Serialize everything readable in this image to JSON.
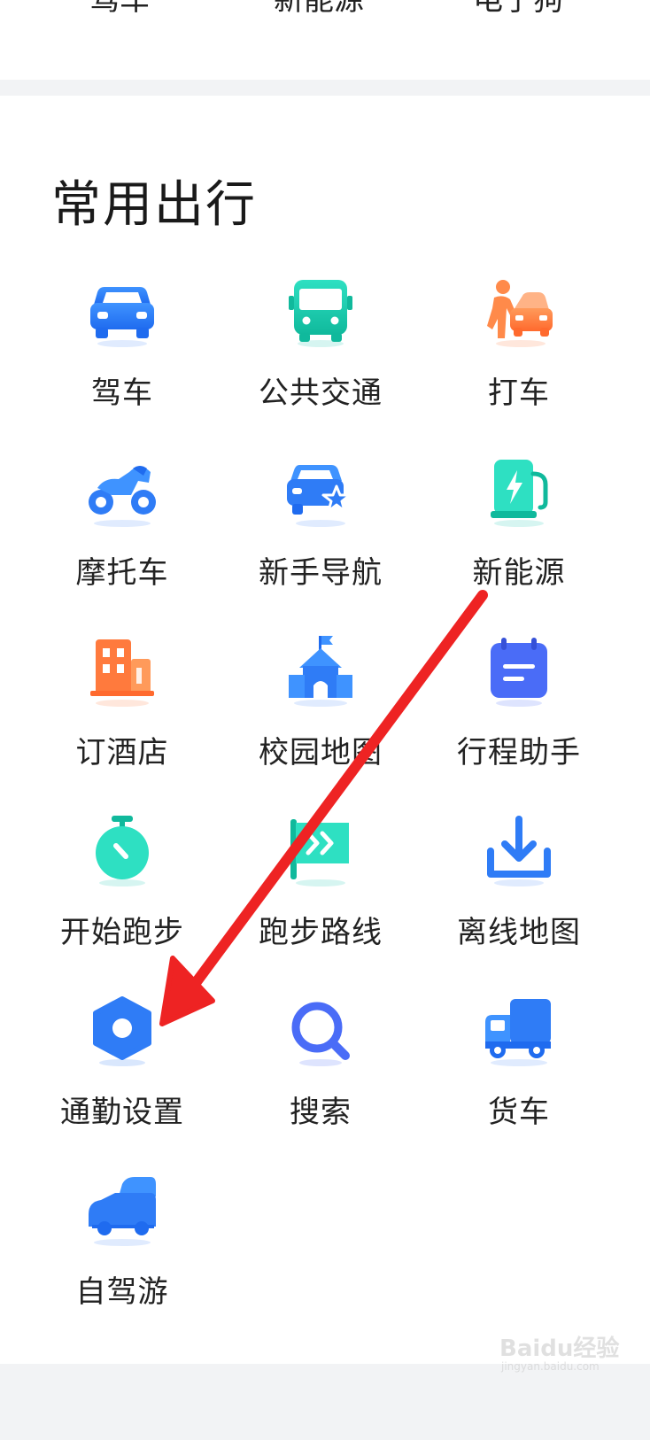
{
  "top_row": [
    "驾车",
    "新能源",
    "电子狗"
  ],
  "section": {
    "title": "常用出行"
  },
  "items": [
    {
      "label": "驾车",
      "icon": "car-icon"
    },
    {
      "label": "公共交通",
      "icon": "bus-icon"
    },
    {
      "label": "打车",
      "icon": "taxi-icon"
    },
    {
      "label": "摩托车",
      "icon": "motorcycle-icon"
    },
    {
      "label": "新手导航",
      "icon": "newbie-car-star-icon"
    },
    {
      "label": "新能源",
      "icon": "charging-station-icon"
    },
    {
      "label": "订酒店",
      "icon": "hotel-icon"
    },
    {
      "label": "校园地图",
      "icon": "campus-icon"
    },
    {
      "label": "行程助手",
      "icon": "calendar-icon"
    },
    {
      "label": "开始跑步",
      "icon": "stopwatch-icon"
    },
    {
      "label": "跑步路线",
      "icon": "route-flag-icon"
    },
    {
      "label": "离线地图",
      "icon": "download-icon"
    },
    {
      "label": "通勤设置",
      "icon": "hex-nut-icon"
    },
    {
      "label": "搜索",
      "icon": "search-icon"
    },
    {
      "label": "货车",
      "icon": "truck-icon"
    },
    {
      "label": "自驾游",
      "icon": "road-trip-car-icon"
    }
  ],
  "colors": {
    "blue": "#2f7cf6",
    "teal": "#19c9b0",
    "orange": "#ff7a3d",
    "annotation_red": "#ee2323",
    "divider": "#f2f3f5"
  },
  "watermark": {
    "brand": "Baidu经验",
    "site": "jingyan.baidu.com"
  }
}
